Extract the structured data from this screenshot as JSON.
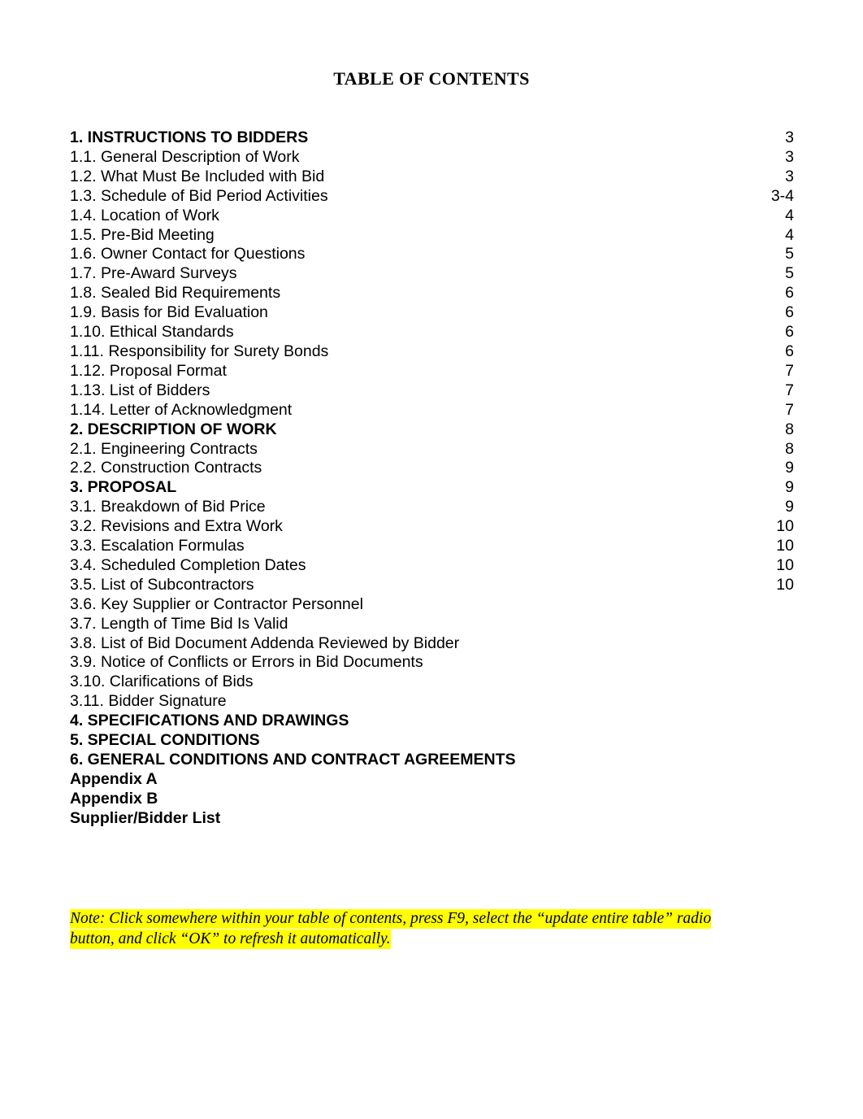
{
  "document": {
    "title": "TABLE OF CONTENTS"
  },
  "toc": {
    "entries": [
      {
        "label": "1. INSTRUCTIONS TO BIDDERS",
        "page": "3",
        "level": 1
      },
      {
        "label": "1.1. General Description of Work",
        "page": "3",
        "level": 2
      },
      {
        "label": "1.2. What Must Be Included with Bid",
        "page": "3",
        "level": 2
      },
      {
        "label": "1.3. Schedule of Bid Period Activities",
        "page": "3-4",
        "level": 2
      },
      {
        "label": "1.4. Location of Work",
        "page": "4",
        "level": 2
      },
      {
        "label": "1.5. Pre-Bid Meeting",
        "page": "4",
        "level": 2
      },
      {
        "label": "1.6. Owner Contact for Questions",
        "page": "5",
        "level": 2
      },
      {
        "label": "1.7. Pre-Award Surveys",
        "page": "5",
        "level": 2
      },
      {
        "label": "1.8. Sealed Bid Requirements",
        "page": "6",
        "level": 2
      },
      {
        "label": "1.9. Basis for Bid Evaluation",
        "page": "6",
        "level": 2
      },
      {
        "label": "1.10. Ethical Standards",
        "page": "6",
        "level": 2
      },
      {
        "label": "1.11. Responsibility for Surety Bonds",
        "page": "6",
        "level": 2
      },
      {
        "label": "1.12. Proposal Format",
        "page": "7",
        "level": 2
      },
      {
        "label": "1.13. List of Bidders",
        "page": "7",
        "level": 2
      },
      {
        "label": "1.14. Letter of Acknowledgment",
        "page": "7",
        "level": 2
      },
      {
        "label": "2. DESCRIPTION OF WORK",
        "page": "8",
        "level": 1
      },
      {
        "label": "2.1. Engineering Contracts",
        "page": "8",
        "level": 2
      },
      {
        "label": "2.2. Construction Contracts",
        "page": "9",
        "level": 2
      },
      {
        "label": "3. PROPOSAL",
        "page": "9",
        "level": 1
      },
      {
        "label": "3.1. Breakdown of Bid Price",
        "page": "9",
        "level": 2
      },
      {
        "label": "3.2. Revisions and Extra Work",
        "page": "10",
        "level": 2
      },
      {
        "label": "3.3. Escalation Formulas",
        "page": "10",
        "level": 2
      },
      {
        "label": "3.4. Scheduled Completion Dates",
        "page": "10",
        "level": 2
      },
      {
        "label": "3.5. List of Subcontractors",
        "page": "10",
        "level": 2
      },
      {
        "label": "3.6. Key Supplier or Contractor Personnel",
        "page": "",
        "level": 2
      },
      {
        "label": "3.7. Length of Time Bid Is Valid",
        "page": "",
        "level": 2
      },
      {
        "label": "3.8. List of Bid Document Addenda Reviewed by Bidder",
        "page": "",
        "level": 2
      },
      {
        "label": "3.9. Notice of Conflicts or Errors in Bid Documents",
        "page": "",
        "level": 2
      },
      {
        "label": "3.10. Clarifications of Bids",
        "page": "",
        "level": 2
      },
      {
        "label": "3.11. Bidder Signature",
        "page": "",
        "level": 2
      },
      {
        "label": "4. SPECIFICATIONS AND DRAWINGS",
        "page": "",
        "level": 1
      },
      {
        "label": "5. SPECIAL CONDITIONS",
        "page": "",
        "level": 1
      },
      {
        "label": "6. GENERAL CONDITIONS AND CONTRACT AGREEMENTS",
        "page": "",
        "level": 1
      },
      {
        "label": "Appendix A",
        "page": "",
        "level": 1
      },
      {
        "label": "Appendix B",
        "page": "",
        "level": 1
      },
      {
        "label": "Supplier/Bidder List",
        "page": "",
        "level": 1
      }
    ]
  },
  "note": {
    "line1": "Note: Click somewhere within your table of contents, press F9, select the “update entire table” radio",
    "line2": "button, and click “OK” to refresh it automatically.",
    "highlight_color": "#ffff00"
  }
}
